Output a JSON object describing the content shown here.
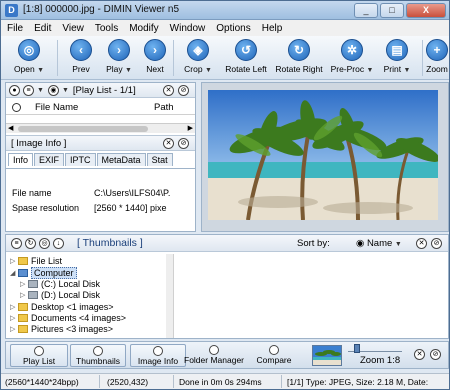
{
  "window": {
    "title": "[1:8] 000000.jpg - DIMIN Viewer n5",
    "minimize": "_",
    "maximize": "□",
    "close": "X"
  },
  "menu": [
    "File",
    "Edit",
    "View",
    "Tools",
    "Modify",
    "Window",
    "Options",
    "Help"
  ],
  "toolbar": {
    "open": "Open",
    "prev": "Prev",
    "play": "Play",
    "next": "Next",
    "crop": "Crop",
    "rotate_left": "Rotate Left",
    "rotate_right": "Rotate Right",
    "preproc": "Pre-Proc",
    "print": "Print",
    "zoom": "Zoom"
  },
  "playlist": {
    "title": "[Play List - 1/1]",
    "col_name": "File Name",
    "col_path": "Path"
  },
  "image_info": {
    "title": "[ Image Info ]",
    "tabs": [
      "Info",
      "EXIF",
      "IPTC",
      "MetaData",
      "Stat"
    ],
    "rows": [
      {
        "key": "File name",
        "value": "C:\\Users\\ILFS04\\P."
      },
      {
        "key": "Spase resolution",
        "value": "[2560 * 1440] pixe"
      }
    ]
  },
  "thumbnails": {
    "title": "[ Thumbnails ]",
    "sort_label": "Sort by:",
    "sort_value": "Name"
  },
  "tree": {
    "file_list": "File List",
    "computer": "Computer",
    "c_drive": "(C:)  Local Disk",
    "d_drive": "(D:)  Local Disk",
    "desktop": "Desktop   <1 images>",
    "documents": "Documents   <4 images>",
    "pictures": "Pictures   <3 images>"
  },
  "bottom": {
    "play_list": "Play List",
    "thumbnails": "Thumbnails",
    "image_info": "Image Info",
    "folder_manager": "Folder Manager",
    "compare": "Compare",
    "zoom": "Zoom 1:8"
  },
  "status": {
    "dims": "(2560*1440*24bpp)",
    "coords": "(2520,432)",
    "timing": "Done in 0m 0s 294ms",
    "fileinfo": "[1/1] Type: JPEG, Size: 2.18 M, Date:"
  }
}
